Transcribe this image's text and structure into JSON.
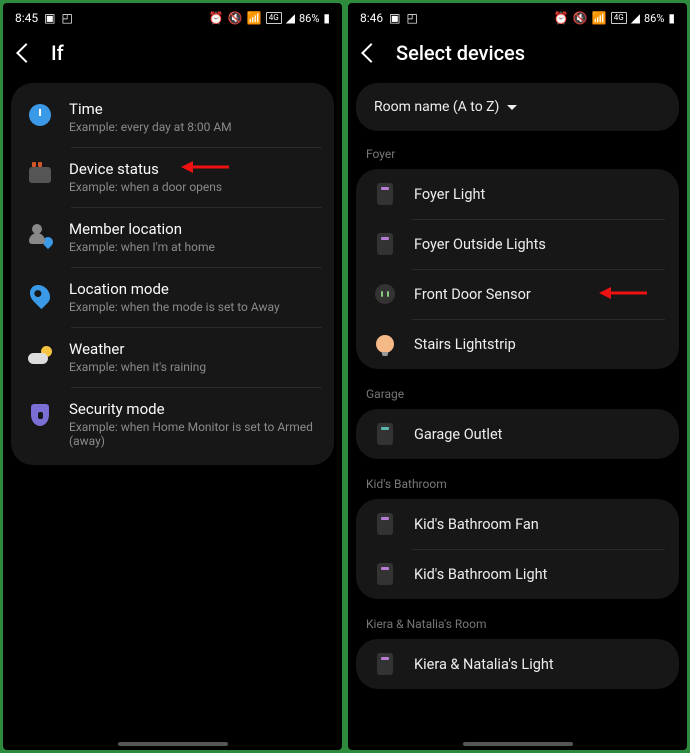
{
  "left": {
    "status": {
      "time": "8:45",
      "battery": "86%",
      "network": "4G"
    },
    "header": "If",
    "items": [
      {
        "icon": "clock",
        "title": "Time",
        "subtitle": "Example: every day at 8:00 AM"
      },
      {
        "icon": "device-status",
        "title": "Device status",
        "subtitle": "Example: when a door opens",
        "arrow": true
      },
      {
        "icon": "member",
        "title": "Member location",
        "subtitle": "Example: when I'm at home"
      },
      {
        "icon": "pin",
        "title": "Location mode",
        "subtitle": "Example: when the mode is set to Away"
      },
      {
        "icon": "weather",
        "title": "Weather",
        "subtitle": "Example: when it's raining"
      },
      {
        "icon": "shield",
        "title": "Security mode",
        "subtitle": "Example: when Home Monitor is set to Armed (away)"
      }
    ]
  },
  "right": {
    "status": {
      "time": "8:46",
      "battery": "86%",
      "network": "4G"
    },
    "header": "Select devices",
    "sort": "Room name (A to Z)",
    "rooms": [
      {
        "name": "Foyer",
        "devices": [
          {
            "icon": "switch-purple",
            "name": "Foyer Light"
          },
          {
            "icon": "switch-purple",
            "name": "Foyer Outside Lights"
          },
          {
            "icon": "sensor",
            "name": "Front Door Sensor",
            "arrow": true
          },
          {
            "icon": "bulb",
            "name": "Stairs Lightstrip"
          }
        ]
      },
      {
        "name": "Garage",
        "devices": [
          {
            "icon": "switch-teal",
            "name": "Garage Outlet"
          }
        ]
      },
      {
        "name": "Kid's Bathroom",
        "devices": [
          {
            "icon": "switch-purple",
            "name": "Kid's Bathroom Fan"
          },
          {
            "icon": "switch-purple",
            "name": "Kid's Bathroom Light"
          }
        ]
      },
      {
        "name": "Kiera & Natalia's Room",
        "devices": [
          {
            "icon": "switch-purple",
            "name": "Kiera & Natalia's Light"
          }
        ]
      }
    ]
  }
}
